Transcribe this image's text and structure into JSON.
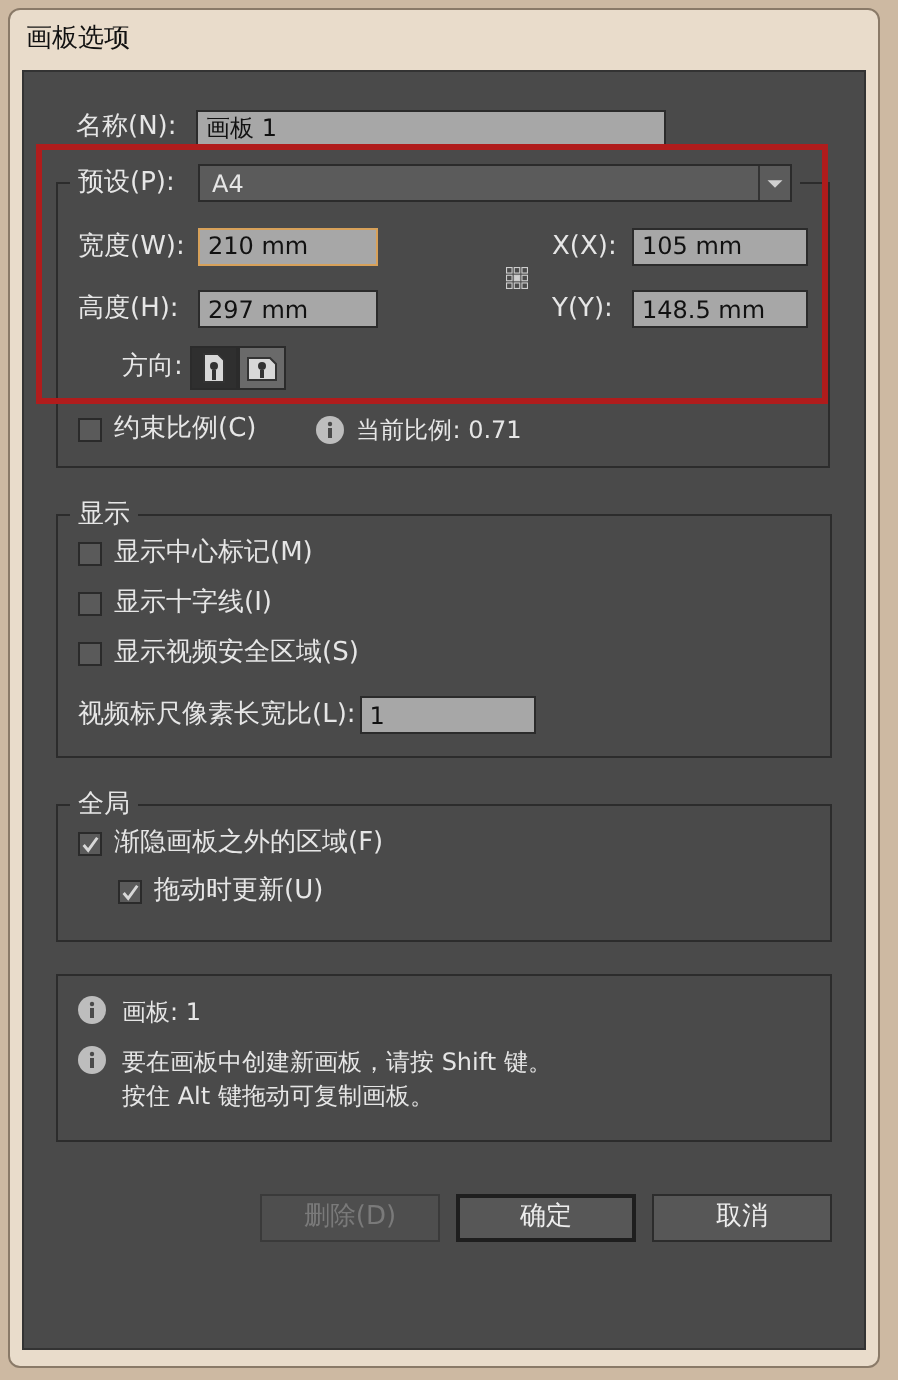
{
  "window": {
    "title": "画板选项"
  },
  "name": {
    "label": "名称(N):",
    "value": "画板 1"
  },
  "preset": {
    "highlighted": true,
    "label": "预设(P):",
    "value": "A4",
    "width": {
      "label": "宽度(W):",
      "value": "210 mm",
      "focused": true
    },
    "height": {
      "label": "高度(H):",
      "value": "297 mm",
      "focused": false
    },
    "x": {
      "label": "X(X):",
      "value": "105 mm"
    },
    "y": {
      "label": "Y(Y):",
      "value": "148.5 mm"
    },
    "orientation": {
      "label": "方向:",
      "options": [
        {
          "kind": "portrait",
          "selected": true
        },
        {
          "kind": "landscape",
          "selected": false
        }
      ]
    },
    "constrain": {
      "label": "约束比例(C)",
      "checked": false
    },
    "current_ratio": "当前比例: 0.71"
  },
  "display": {
    "title": "显示",
    "options": [
      {
        "label": "显示中心标记(M)",
        "checked": false
      },
      {
        "label": "显示十字线(I)",
        "checked": false
      },
      {
        "label": "显示视频安全区域(S)",
        "checked": false
      }
    ],
    "ratio": {
      "label": "视频标尺像素长宽比(L):",
      "value": "1"
    }
  },
  "global": {
    "title": "全局",
    "options": [
      {
        "label": "渐隐画板之外的区域(F)",
        "checked": true,
        "indented": false
      },
      {
        "label": "拖动时更新(U)",
        "checked": true,
        "indented": true
      }
    ]
  },
  "info": [
    {
      "lines": [
        "画板: 1"
      ]
    },
    {
      "lines": [
        "要在画板中创建新画板，请按 Shift 键。",
        "按住 Alt 键拖动可复制画板。"
      ]
    }
  ],
  "buttons": [
    {
      "label": "删除(D)",
      "disabled": true,
      "default": false
    },
    {
      "label": "确定",
      "disabled": false,
      "default": true
    },
    {
      "label": "取消",
      "disabled": false,
      "default": false
    }
  ]
}
